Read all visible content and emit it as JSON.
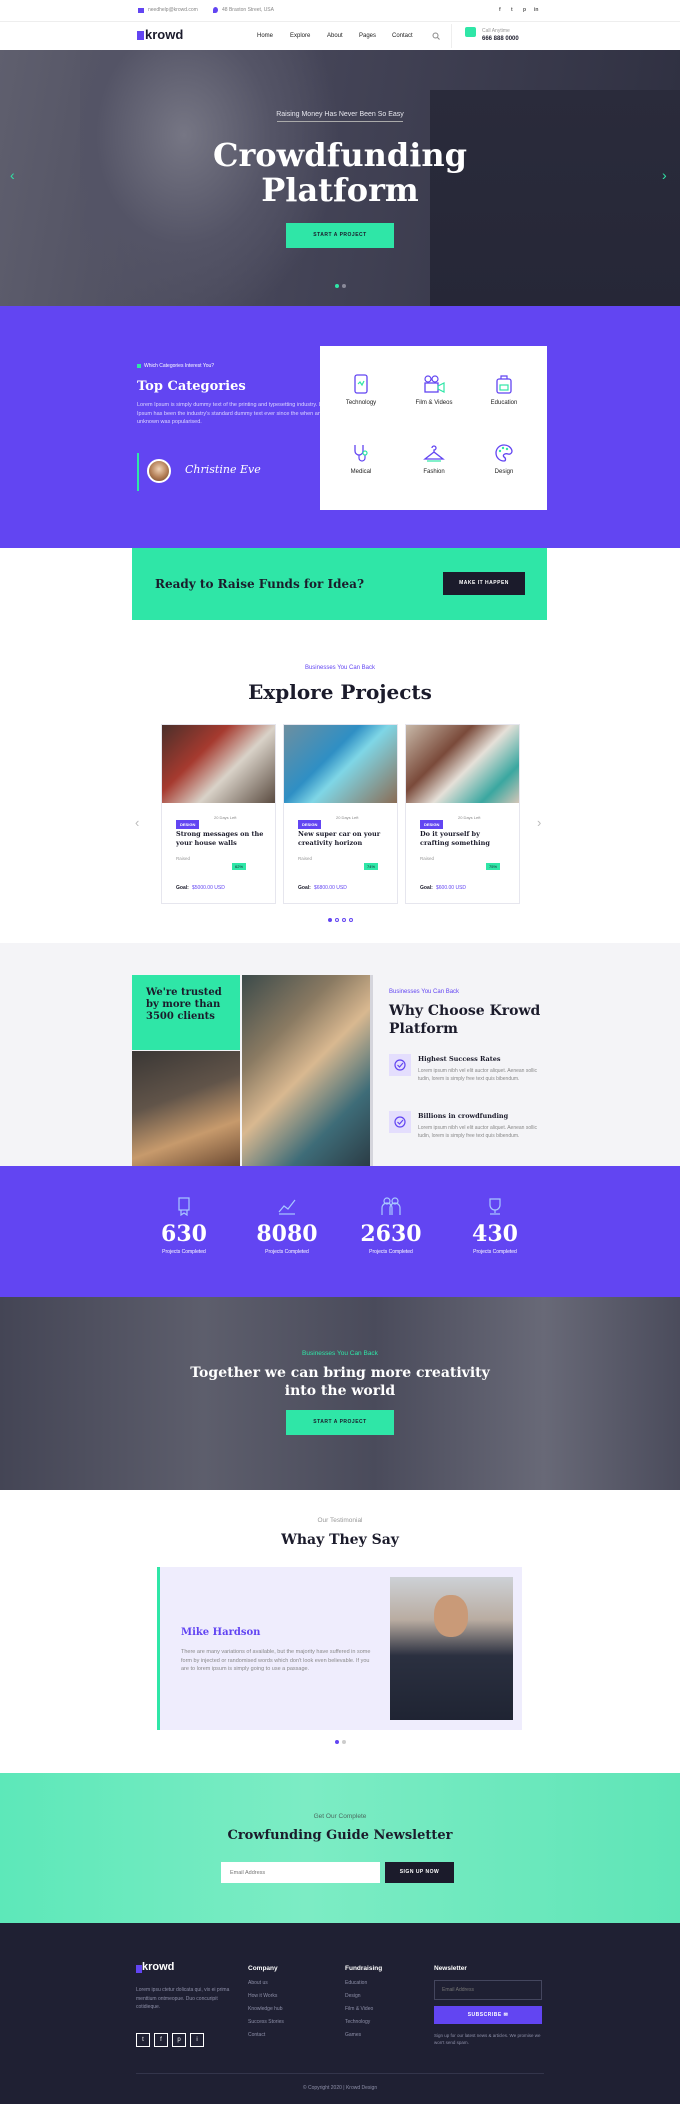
{
  "topbar": {
    "email": "needhelp@krowd.com",
    "address": "48 Braxton Street, USA",
    "social": [
      "f",
      "t",
      "p",
      "in"
    ]
  },
  "nav": {
    "logo": "krowd",
    "items": [
      "Home",
      "Explore",
      "About",
      "Pages",
      "Contact"
    ],
    "call_label": "Call Anytime",
    "phone": "666 888 0000"
  },
  "hero": {
    "tagline": "Raising Money Has Never Been So Easy",
    "title_line1": "Crowdfunding",
    "title_line2": "Platform",
    "button": "START A PROJECT",
    "prev": "‹",
    "next": "›"
  },
  "categories": {
    "eyebrow": "Which Categories Interest You?",
    "title": "Top Categories",
    "text": "Lorem Ipsum is simply dummy text of the printing and typesetting industry. Lorem Ipsum has been the industry's standard dummy text ever since the when an unknown was popularised.",
    "signature": "Christine Eve",
    "items": [
      "Technology",
      "Film & Videos",
      "Education",
      "Medical",
      "Fashion",
      "Design"
    ]
  },
  "cta": {
    "title": "Ready to Raise Funds for Idea?",
    "button": "MAKE IT HAPPEN"
  },
  "projects": {
    "eyebrow": "Businesses You Can Back",
    "title": "Explore Projects",
    "goal_label": "Goal:",
    "items": [
      {
        "tag": "DESIGN",
        "days": "20 Days Left",
        "title": "Strong messages on the your house walls",
        "raised": "Raised",
        "pct": "62%",
        "pct_num": 62,
        "goal": "$5000.00 USD"
      },
      {
        "tag": "DESIGN",
        "days": "20 Days Left",
        "title": "New super car on your creativity horizon",
        "raised": "Raised",
        "pct": "74%",
        "pct_num": 74,
        "goal": "$6800.00 USD"
      },
      {
        "tag": "DESIGN",
        "days": "20 Days Left",
        "title": "Do it yourself by crafting something",
        "raised": "Raised",
        "pct": "75%",
        "pct_num": 75,
        "goal": "$600.00 USD"
      }
    ]
  },
  "why": {
    "badge": "We're trusted by more than 3500 clients",
    "eyebrow": "Businesses You Can Back",
    "title_line1": "Why Choose Krowd",
    "title_line2": "Platform",
    "feature1_title": "Highest Success Rates",
    "feature1_text": "Lorem ipsum nibh vel elit auctor aliquet. Aenean sollic tudin, lorem is simply free text quis bibendum.",
    "feature2_title": "Billions in crowdfunding",
    "feature2_text": "Lorem ipsum nibh vel elit auctor aliquet. Aenean sollic tudin, lorem is simply free text quis bibendum."
  },
  "stats": [
    {
      "num": "630",
      "label": "Projects Completed"
    },
    {
      "num": "8080",
      "label": "Projects Completed"
    },
    {
      "num": "2630",
      "label": "Projects Completed"
    },
    {
      "num": "430",
      "label": "Projects Completed"
    }
  ],
  "banner": {
    "eyebrow": "Businesses You Can Back",
    "line1": "Together we can bring more creativity",
    "line2": "into the world",
    "button": "START A PROJECT"
  },
  "testimonial": {
    "eyebrow": "Our Testimonial",
    "title": "Whay They Say",
    "name": "Mike Hardson",
    "text": "There are many variations of available, but the majority have suffered in some form by injected or randomised words which don't look even believable. If you are to lorem ipsum is simply going to use a passage."
  },
  "newsletter": {
    "eyebrow": "Get Our Complete",
    "title": "Crowfunding Guide Newsletter",
    "placeholder": "Email Address",
    "button": "SIGN UP NOW"
  },
  "footer": {
    "logo": "krowd",
    "about": "Lorem ipsu ctetur dolicata qui, vix ei prima menttium ontmeopue. Duo concuripit cotidieque.",
    "company_title": "Company",
    "company": [
      "About us",
      "How it Works",
      "Knowledge hub",
      "Success Stories",
      "Contact"
    ],
    "fund_title": "Fundraising",
    "fund": [
      "Education",
      "Design",
      "Film & Video",
      "Technology",
      "Games"
    ],
    "news_title": "Newsletter",
    "email_placeholder": "Email Address",
    "subscribe": "SUBSCRIBE",
    "note": "Sign up for our latest news & articles. We promise we won't send spam.",
    "copyright": "© Copyright 2020 | Krowd Design"
  }
}
